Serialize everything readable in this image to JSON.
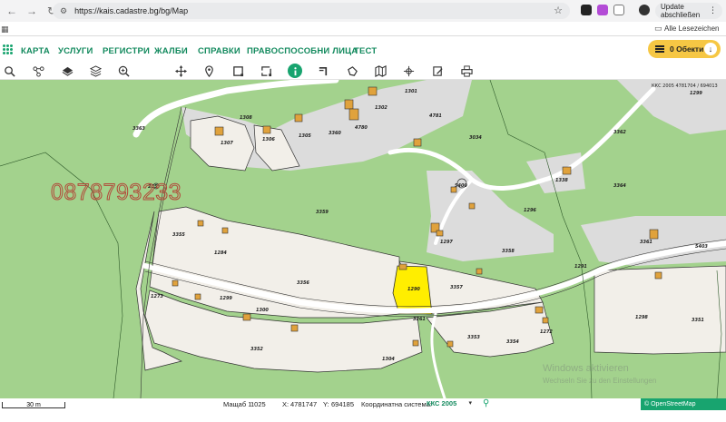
{
  "browser": {
    "url": "https://kais.cadastre.bg/bg/Map",
    "update_label": "Update abschließen",
    "bookmarks_label": "Alle Lesezeichen"
  },
  "menu": {
    "items": [
      "КАРТА",
      "УСЛУГИ",
      "РЕГИСТРИ",
      "ЖАЛБИ",
      "СПРАВКИ",
      "ПРАВОСПОСОБНИ ЛИЦА",
      "ТЕСТ"
    ],
    "objects_button": "0 Обекти"
  },
  "toolbar": {
    "tools": [
      "search-icon",
      "nodes-icon",
      "layers-icon",
      "layers-stack-icon",
      "zoom-in-icon",
      "move-icon",
      "pin-icon",
      "select-rect-icon",
      "select-poly-icon",
      "info-icon",
      "corner-icon",
      "polygon-icon",
      "map-icon",
      "crosshair-icon",
      "edit-icon",
      "print-icon"
    ]
  },
  "map": {
    "phone_watermark": "0878793233",
    "parcel_labels": [
      "1290",
      "3357",
      "3356",
      "3358",
      "3359",
      "3355",
      "1284",
      "3352",
      "3353",
      "3354",
      "3351",
      "1272",
      "1297",
      "1296",
      "3360",
      "1305",
      "1306",
      "1307",
      "1301",
      "1302",
      "4781",
      "4780",
      "3034",
      "3362",
      "3361",
      "1298",
      "1273",
      "1299",
      "1300",
      "3261",
      "1304",
      "1308",
      "1338",
      "1299",
      "3363",
      "3364",
      "5403",
      "5400",
      "235",
      "1291"
    ],
    "top_right_label": "ККС 2005 4781704 / 694013",
    "windows_watermark": "Windows aktivieren",
    "windows_watermark_sub": "Wechseln Sie zu den Einstellungen"
  },
  "scale_bar": "30 m",
  "status": {
    "scale_label": "Мащаб 1:",
    "scale_value": "1025",
    "x_label": "X:",
    "x_value": "4781747",
    "y_label": "Y:",
    "y_value": "694185",
    "crs_label": "Координатна система:",
    "crs_value": "ККС 2005"
  },
  "osm_credit": "© OpenStreetMap contributors.",
  "colors": {
    "accent": "#18a46f",
    "map_green": "#a3d28d",
    "parcel_fill": "#f2efe9",
    "building": "#e0a23c",
    "highlight": "#ffee00"
  }
}
